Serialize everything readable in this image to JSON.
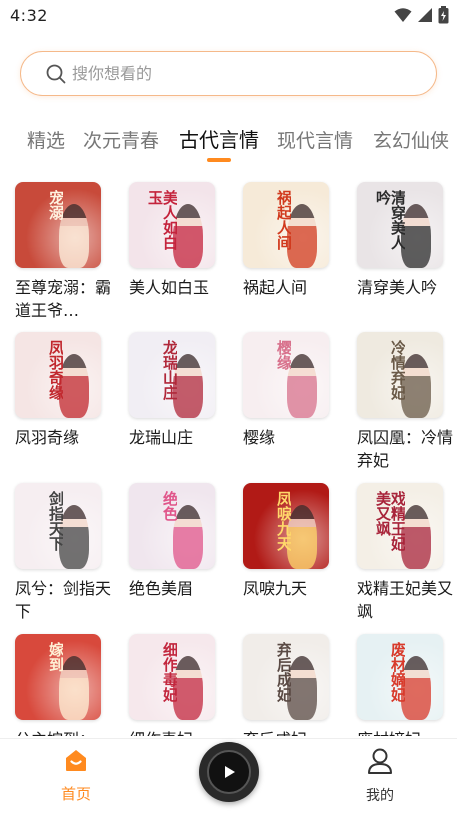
{
  "status_bar": {
    "time": "4:32"
  },
  "search": {
    "placeholder": "搜你想看的"
  },
  "tabs": [
    {
      "label": "精选"
    },
    {
      "label": "次元青春"
    },
    {
      "label": "古代言情"
    },
    {
      "label": "现代言情"
    },
    {
      "label": "玄幻仙侠"
    }
  ],
  "active_tab": "古代言情",
  "books": [
    {
      "title": "至尊宠溺：霸道王爷…"
    },
    {
      "title": "美人如白玉"
    },
    {
      "title": "祸起人间"
    },
    {
      "title": "清穿美人吟"
    },
    {
      "title": "凤羽奇缘"
    },
    {
      "title": "龙瑞山庄"
    },
    {
      "title": "樱缘"
    },
    {
      "title": "凤囚凰：冷情弃妃"
    },
    {
      "title": "凤兮：剑指天下"
    },
    {
      "title": "绝色美眉"
    },
    {
      "title": "凤唳九天"
    },
    {
      "title": "戏精王妃美又飒"
    },
    {
      "title": "公主嫁到："
    },
    {
      "title": "细作毒妃"
    },
    {
      "title": "弃后成妃"
    },
    {
      "title": "废材嫡妃"
    }
  ],
  "covers": [
    {
      "text": "宠溺",
      "bg": "#c84a3a",
      "fg": "#fff3e0"
    },
    {
      "text": "美人如白玉",
      "bg": "#f3e4ea",
      "fg": "#c4233c"
    },
    {
      "text": "祸起人间",
      "bg": "#f6ead8",
      "fg": "#d13a1e"
    },
    {
      "text": "清穿美人吟",
      "bg": "#e9e4e6",
      "fg": "#2b2b2b"
    },
    {
      "text": "凤羽奇缘",
      "bg": "#f5e5e4",
      "fg": "#c1272d"
    },
    {
      "text": "龙瑞山庄",
      "bg": "#f1eef4",
      "fg": "#b0283a"
    },
    {
      "text": "樱缘",
      "bg": "#f7eef0",
      "fg": "#d8718c"
    },
    {
      "text": "冷情弃妃",
      "bg": "#efeae0",
      "fg": "#6a5a48"
    },
    {
      "text": "剑指天下",
      "bg": "#f6eef1",
      "fg": "#444"
    },
    {
      "text": "绝色",
      "bg": "#f0e6ee",
      "fg": "#e0558a"
    },
    {
      "text": "凤唳九天",
      "bg": "#b11a16",
      "fg": "#ffd86a"
    },
    {
      "text": "戏精王妃美又飒",
      "bg": "#f4efe6",
      "fg": "#a8243a"
    },
    {
      "text": "嫁到",
      "bg": "#d8493c",
      "fg": "#fff1d6"
    },
    {
      "text": "细作毒妃",
      "bg": "#f6e8ec",
      "fg": "#c2273e"
    },
    {
      "text": "弃后成妃",
      "bg": "#f1ede9",
      "fg": "#5a4a44"
    },
    {
      "text": "废材嫡妃",
      "bg": "#e6f1f3",
      "fg": "#d83a2b"
    }
  ],
  "bottom_nav": {
    "home_label": "首页",
    "mine_label": "我的"
  },
  "colors": {
    "accent": "#ff8a1f",
    "search_border": "#f5b98a"
  },
  "icons": [
    "wifi-icon",
    "signal-icon",
    "battery-icon",
    "search-icon",
    "home-icon",
    "play-icon",
    "user-icon"
  ]
}
